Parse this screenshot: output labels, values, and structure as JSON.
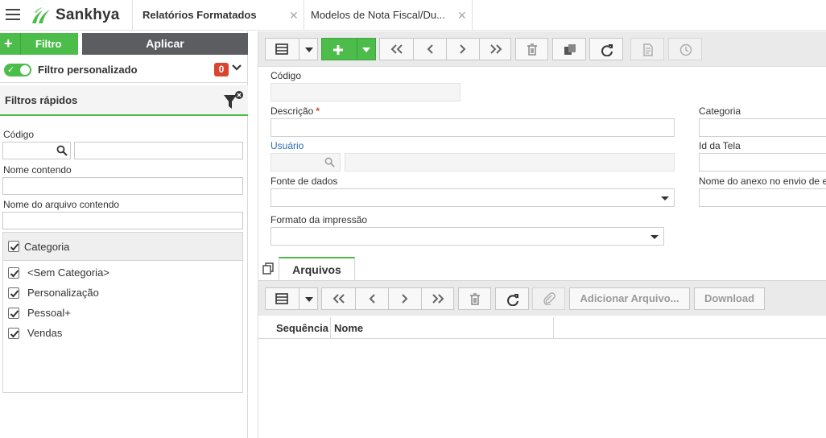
{
  "app": {
    "brand": "Sankhya",
    "brand_color": "#4cbd4a"
  },
  "tabs": [
    {
      "label": "Relatórios Formatados",
      "active": true
    },
    {
      "label": "Modelos de Nota Fiscal/Du...",
      "active": false
    }
  ],
  "left_panel": {
    "filter_button": "Filtro",
    "apply_button": "Aplicar",
    "custom_filter": {
      "label": "Filtro personalizado",
      "enabled": true,
      "count": "0"
    },
    "quick_filters": {
      "title": "Filtros rápidos",
      "fields": {
        "codigo": "Código",
        "nome_contendo": "Nome contendo",
        "nome_arquivo": "Nome do arquivo contendo"
      },
      "categoria": {
        "label": "Categoria",
        "checked": true,
        "items": [
          {
            "label": "<Sem Categoria>",
            "checked": true
          },
          {
            "label": "Personalização",
            "checked": true
          },
          {
            "label": "Pessoal+",
            "checked": true
          },
          {
            "label": "Vendas",
            "checked": true
          }
        ]
      }
    }
  },
  "form": {
    "codigo_label": "Código",
    "descricao_label": "Descrição",
    "required_mark": "*",
    "usuario_label": "Usuário",
    "fonte_label": "Fonte de dados",
    "formato_label": "Formato da impressão",
    "categoria_label": "Categoria",
    "id_tela_label": "Id da Tela",
    "anexo_label": "Nome do anexo no envio de e"
  },
  "arquivos": {
    "tab_label": "Arquivos",
    "add_button": "Adicionar Arquivo...",
    "download_button": "Download",
    "columns": [
      "Sequência",
      "Nome"
    ]
  }
}
